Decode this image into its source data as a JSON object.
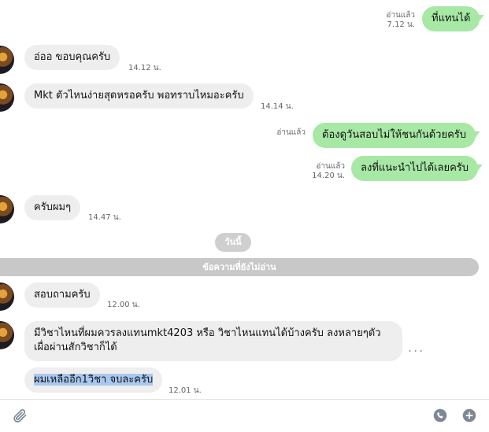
{
  "messages": {
    "m1": {
      "text": "ที่แทนได้",
      "status": "อ่านแล้ว",
      "time": "7.12 น."
    },
    "m2": {
      "text": "อ่ออ  ขอบคุณครับ",
      "time": "14.12 น."
    },
    "m3": {
      "text": "Mkt ตัวไหนง่ายสุดหรอครับ พอทราบไหมอะครับ",
      "time": "14.14 น."
    },
    "m4": {
      "text": "ต้องดูวันสอบไม่ให้ชนกันด้วยครับ",
      "status": "อ่านแล้ว"
    },
    "m5": {
      "text": "ลงที่แนะนำไปได้เลยครับ",
      "status": "อ่านแล้ว",
      "time": "14.20 น."
    },
    "m6": {
      "text": "ครับผมๆ",
      "time": "14.47 น."
    },
    "m7": {
      "text": "สอบถามครับ",
      "time": "12.00 น."
    },
    "m8": {
      "line1": "มีวิชาไหนที่ผมควรลงแทนmkt4203 หรือ วิชาไหนแทนได้บ้างครับ ลงหลายๆตัว",
      "line2": "เผื่อผ่านสักวิชาก็ได้"
    },
    "m9": {
      "text": "ผมเหลืออีก1วิชา จบละครับ",
      "time": "12.01 น."
    }
  },
  "separators": {
    "day": "วันนี้",
    "unread": "ข้อความที่ยังไม่อ่าน"
  },
  "more_menu": "...",
  "footer": {
    "icons": [
      "paperclip-icon",
      "call-icon",
      "add-icon"
    ]
  },
  "colors": {
    "outgoing_bubble": "#a7e8a5",
    "incoming_bubble": "#eeeeee",
    "highlight": "#a9c8f0"
  }
}
